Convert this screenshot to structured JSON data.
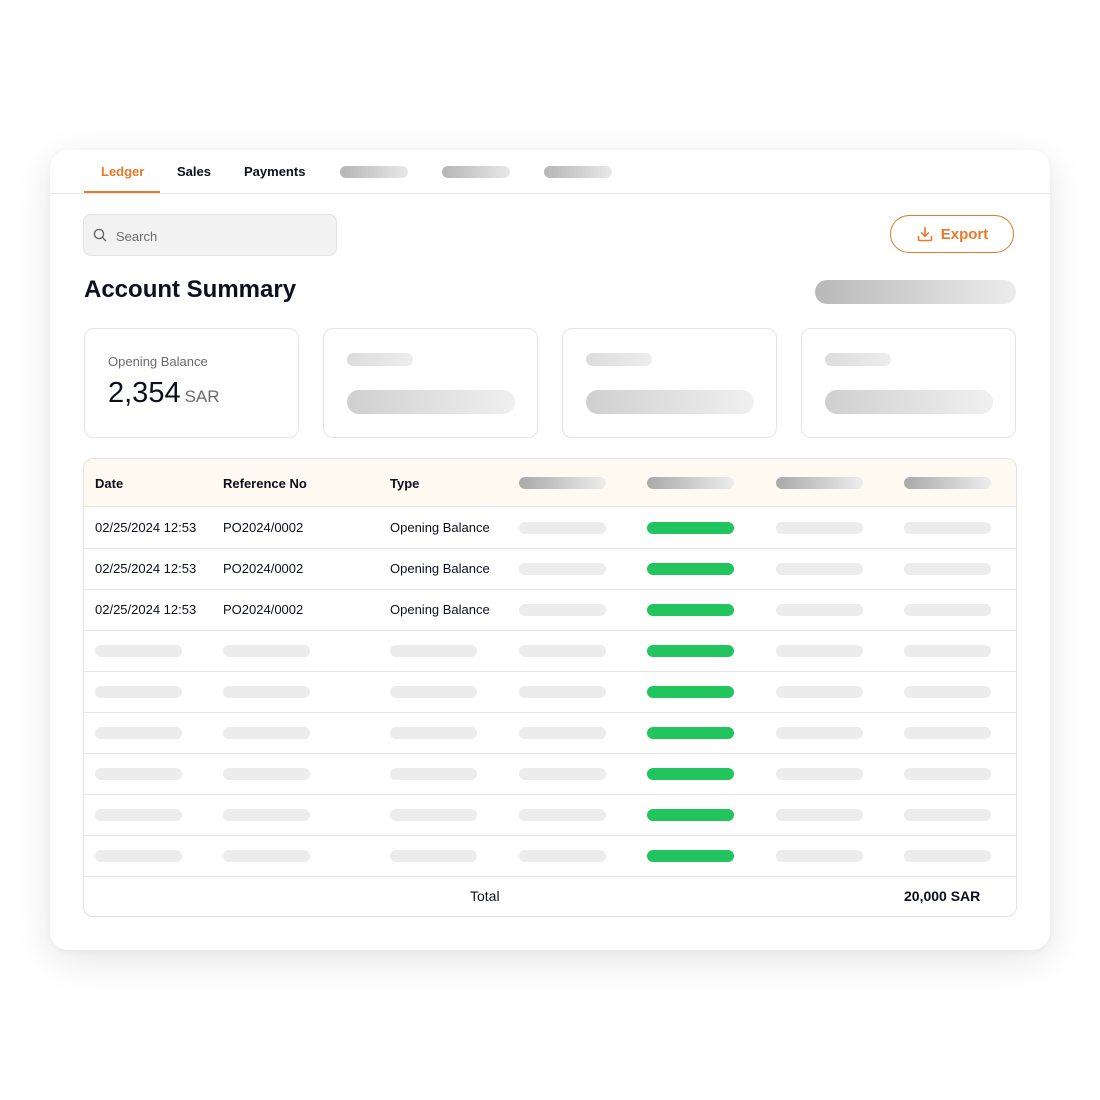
{
  "tabs": [
    {
      "label": "Ledger",
      "active": true
    },
    {
      "label": "Sales",
      "active": false
    },
    {
      "label": "Payments",
      "active": false
    }
  ],
  "search": {
    "placeholder": "Search",
    "icon": "search-icon"
  },
  "export_button": {
    "label": "Export",
    "icon": "download-icon"
  },
  "page_title": "Account Summary",
  "summary": {
    "opening_balance": {
      "label": "Opening Balance",
      "value": "2,354",
      "unit": "SAR"
    }
  },
  "table": {
    "columns": [
      "Date",
      "Reference No",
      "Type"
    ],
    "rows": [
      {
        "date": "02/25/2024 12:53",
        "reference": "PO2024/0002",
        "type": "Opening Balance"
      },
      {
        "date": "02/25/2024 12:53",
        "reference": "PO2024/0002",
        "type": "Opening Balance"
      },
      {
        "date": "02/25/2024 12:53",
        "reference": "PO2024/0002",
        "type": "Opening Balance"
      }
    ],
    "placeholder_rows": 6,
    "total_label": "Total",
    "total_value": "20,000 SAR"
  },
  "colors": {
    "accent": "#e9782a",
    "status_green": "#22c45e",
    "header_bg": "#fffaf1"
  }
}
